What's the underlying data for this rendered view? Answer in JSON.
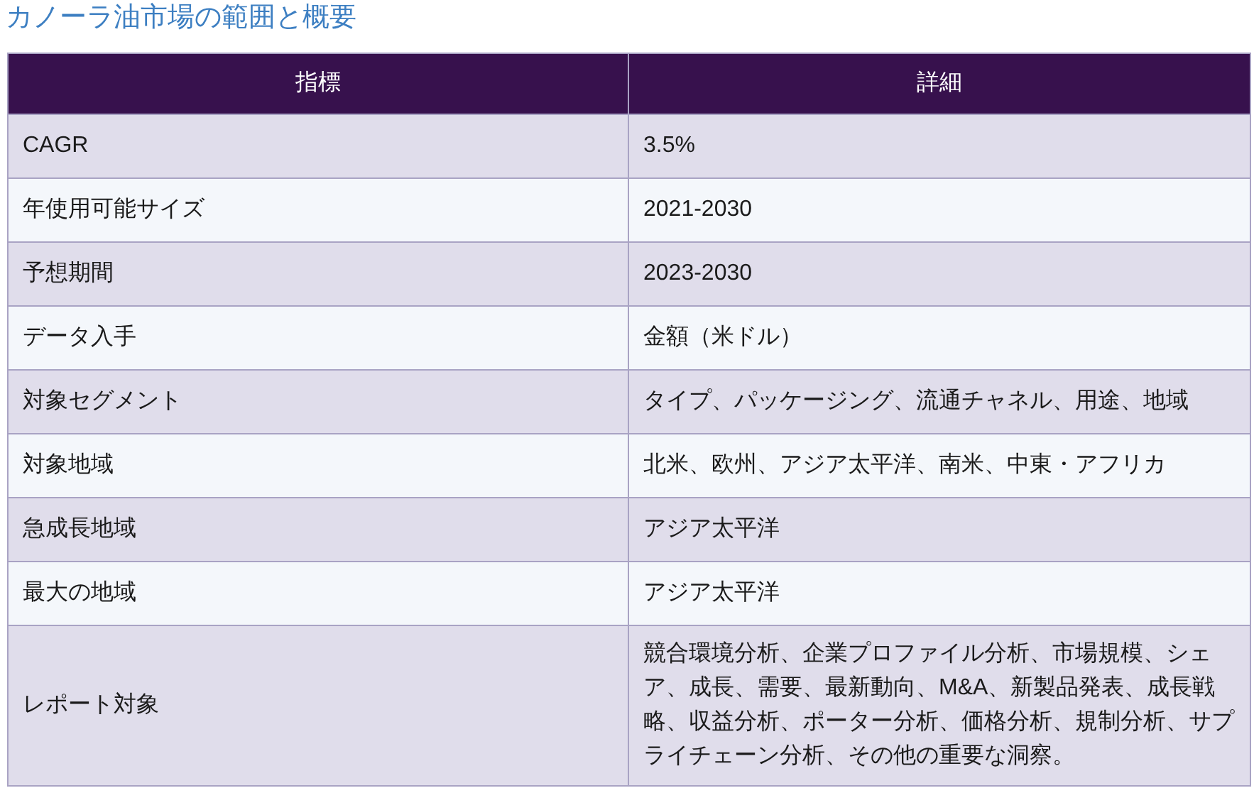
{
  "title": "カノーラ油市場の範囲と概要",
  "table": {
    "columns": [
      "指標",
      "詳細"
    ],
    "rows": [
      [
        "CAGR",
        "3.5%"
      ],
      [
        "年使用可能サイズ",
        "2021-2030"
      ],
      [
        "予想期間",
        "2023-2030"
      ],
      [
        "データ入手",
        "金額（米ドル）"
      ],
      [
        "対象セグメント",
        "タイプ、パッケージング、流通チャネル、用途、地域"
      ],
      [
        "対象地域",
        "北米、欧州、アジア太平洋、南米、中東・アフリカ"
      ],
      [
        "急成長地域",
        "アジア太平洋"
      ],
      [
        "最大の地域",
        "アジア太平洋"
      ],
      [
        "レポート対象",
        "競合環境分析、企業プロファイル分析、市場規模、シェア、成長、需要、最新動向、M&A、新製品発表、成長戦略、収益分析、ポーター分析、価格分析、規制分析、サプライチェーン分析、その他の重要な洞察。"
      ]
    ]
  }
}
